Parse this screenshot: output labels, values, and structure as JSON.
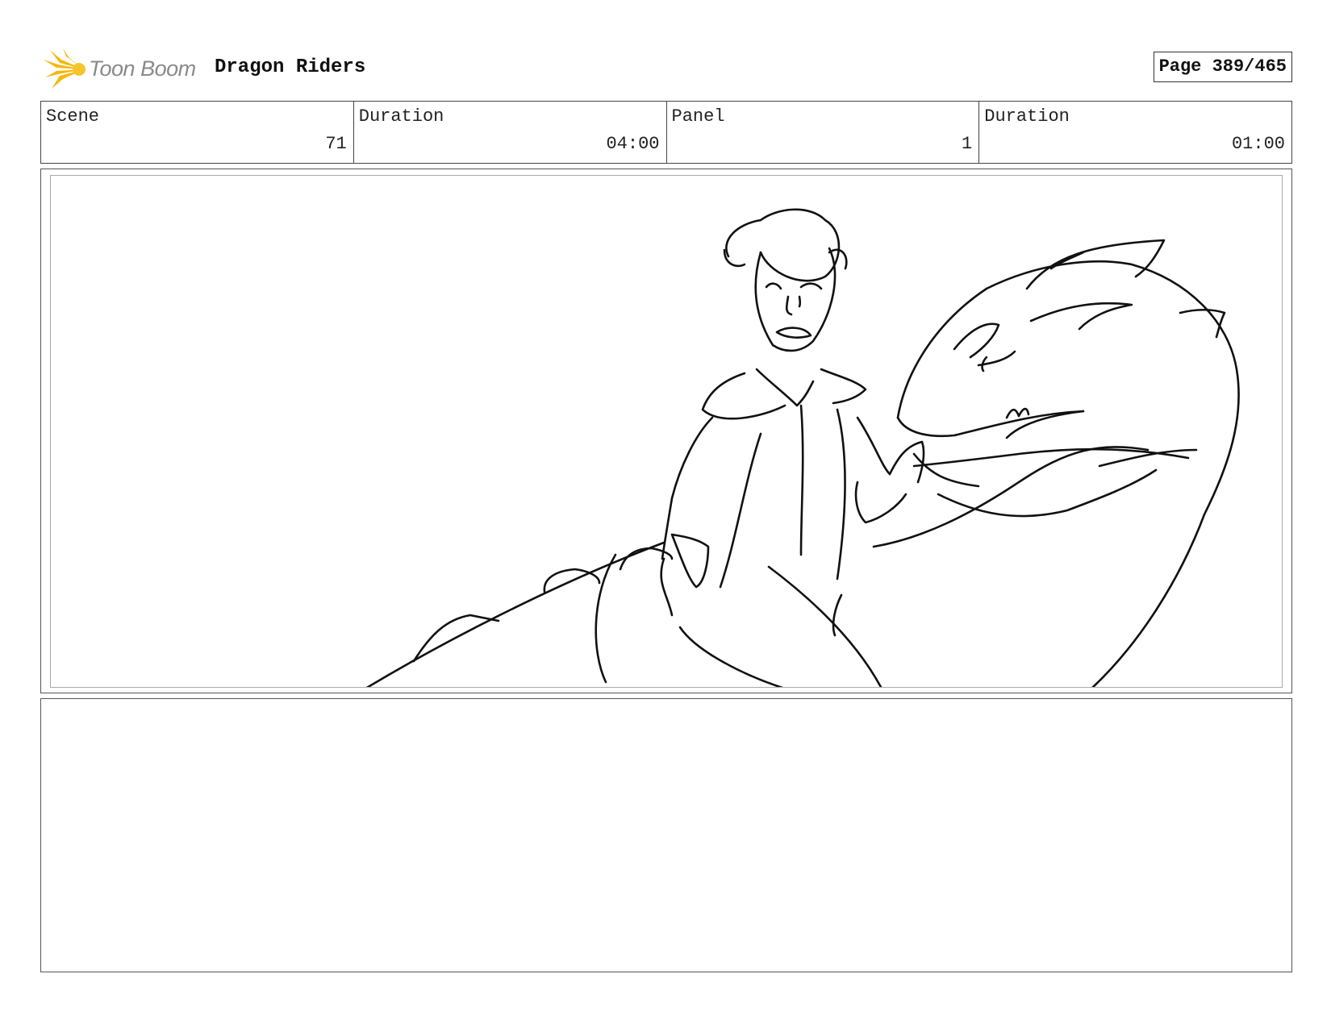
{
  "header": {
    "brand": "Toon Boom",
    "project_title": "Dragon Riders",
    "page_label": "Page 389/465",
    "brand_color": "#f5b80f"
  },
  "info": [
    {
      "label": "Scene",
      "value": "71"
    },
    {
      "label": "Duration",
      "value": "04:00"
    },
    {
      "label": "Panel",
      "value": "1"
    },
    {
      "label": "Duration",
      "value": "01:00"
    }
  ],
  "panel": {
    "image": "sketch-boy-riding-dragon"
  },
  "notes": {
    "text": ""
  }
}
